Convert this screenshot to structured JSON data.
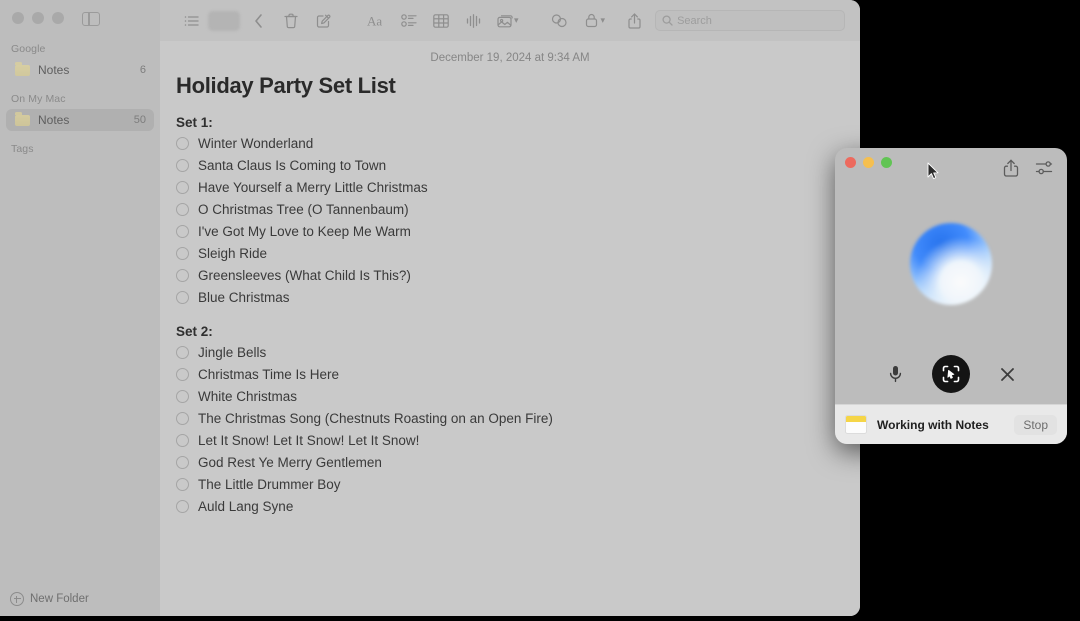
{
  "window": {
    "title": "Notes",
    "traffic_lights": [
      "close",
      "minimize",
      "zoom"
    ]
  },
  "sidebar": {
    "sections": [
      {
        "label": "Google"
      },
      {
        "label": "On My Mac"
      },
      {
        "label": "Tags"
      }
    ],
    "accounts": [
      {
        "label": "Notes",
        "count": "6",
        "selected": false
      },
      {
        "label": "Notes",
        "count": "50",
        "selected": true
      }
    ],
    "new_folder_label": "New Folder",
    "sidebar_toggle_icon": "sidebar-toggle-icon"
  },
  "toolbar": {
    "icons": [
      "list-view-icon",
      "blurred-button",
      "back-chevron-icon",
      "trash-icon",
      "compose-note-icon",
      "format-text-icon",
      "checklist-icon",
      "table-icon",
      "audio-waveform-icon",
      "media-icon",
      "collaborate-icon",
      "lock-icon",
      "share-icon"
    ],
    "search": {
      "placeholder": "Search"
    }
  },
  "note": {
    "date": "December 19, 2024 at 9:34 AM",
    "title": "Holiday Party Set List",
    "sets": [
      {
        "heading": "Set 1:",
        "items": [
          "Winter Wonderland",
          "Santa Claus Is Coming to Town",
          "Have Yourself a Merry Little Christmas",
          "O Christmas Tree (O Tannenbaum)",
          "I've Got My Love to Keep Me Warm",
          "Sleigh Ride",
          "Greensleeves (What Child Is This?)",
          "Blue Christmas"
        ]
      },
      {
        "heading": "Set 2:",
        "items": [
          "Jingle Bells",
          "Christmas Time Is Here",
          "White Christmas",
          "The Christmas Song (Chestnuts Roasting on an Open Fire)",
          "Let It Snow! Let It Snow! Let It Snow!",
          "God Rest Ye Merry Gentlemen",
          "The Little Drummer Boy",
          "Auld Lang Syne"
        ]
      }
    ]
  },
  "assistant": {
    "titlebar": {
      "share_icon": "share-icon",
      "settings_icon": "settings-sliders-icon",
      "cursor": "mouse-pointer-icon"
    },
    "orb": "assistant-orb",
    "controls": {
      "mic": "microphone-icon",
      "main": "screen-control-icon",
      "close": "close-x-icon"
    },
    "status": {
      "app_icon": "notes-app-icon",
      "text": "Working with Notes",
      "stop_label": "Stop"
    }
  },
  "colors": {
    "accent_blue": "#3a88ff",
    "note_yellow": "#f5d547",
    "traffic_red": "#ed6a5e",
    "traffic_yellow": "#f5bf4f",
    "traffic_green": "#61c454",
    "desktop_bg": "#000000"
  }
}
